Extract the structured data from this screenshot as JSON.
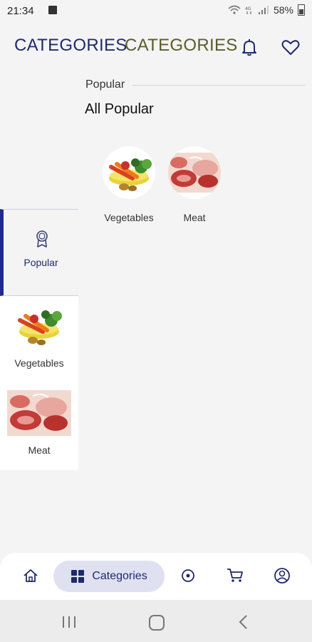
{
  "status": {
    "time": "21:34",
    "battery": "58%"
  },
  "header": {
    "title_primary": "CATEGORIES",
    "title_secondary": "CATEGORIES"
  },
  "section": {
    "label": "Popular",
    "title": "All Popular"
  },
  "popular_items": [
    {
      "label": "Vegetables",
      "icon": "vegetables-image"
    },
    {
      "label": "Meat",
      "icon": "meat-image"
    }
  ],
  "sidebar": {
    "items": [
      {
        "label": "Popular",
        "icon": "ribbon-icon",
        "active": true
      },
      {
        "label": "Vegetables",
        "icon": "vegetables-image"
      },
      {
        "label": "Meat",
        "icon": "meat-image"
      }
    ]
  },
  "bottom_nav": {
    "active_label": "Categories",
    "items": [
      "home-icon",
      "categories-icon",
      "target-icon",
      "cart-icon",
      "profile-icon"
    ]
  },
  "colors": {
    "primary": "#1f2a6b",
    "accent_olive": "#5c5c2a",
    "nav_active_bg": "#dfe1f1"
  }
}
